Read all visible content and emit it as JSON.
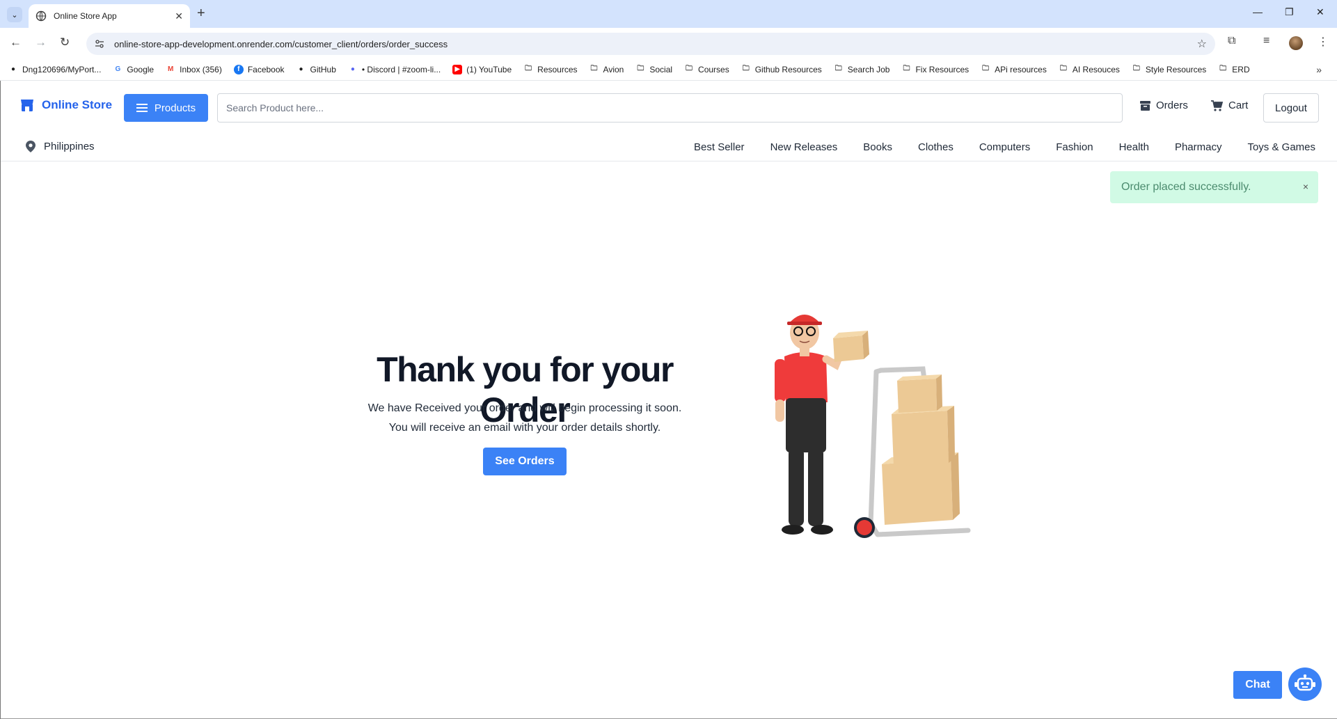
{
  "browser": {
    "tab_title": "Online Store App",
    "url": "online-store-app-development.onrender.com/customer_client/orders/order_success",
    "bookmarks": [
      {
        "label": "Dng120696/MyPort...",
        "icon": "github-icon"
      },
      {
        "label": "Google",
        "icon": "google-icon"
      },
      {
        "label": "Inbox (356)",
        "icon": "gmail-icon"
      },
      {
        "label": "Facebook",
        "icon": "facebook-icon"
      },
      {
        "label": "GitHub",
        "icon": "github-icon"
      },
      {
        "label": "• Discord | #zoom-li...",
        "icon": "discord-icon"
      },
      {
        "label": "(1) YouTube",
        "icon": "youtube-icon"
      },
      {
        "label": "Resources",
        "icon": "folder-icon"
      },
      {
        "label": "Avion",
        "icon": "folder-icon"
      },
      {
        "label": "Social",
        "icon": "folder-icon"
      },
      {
        "label": "Courses",
        "icon": "folder-icon"
      },
      {
        "label": "Github Resources",
        "icon": "folder-icon"
      },
      {
        "label": "Search Job",
        "icon": "folder-icon"
      },
      {
        "label": "Fix Resources",
        "icon": "folder-icon"
      },
      {
        "label": "APi resources",
        "icon": "folder-icon"
      },
      {
        "label": "AI Resouces",
        "icon": "folder-icon"
      },
      {
        "label": "Style Resources",
        "icon": "folder-icon"
      },
      {
        "label": "ERD",
        "icon": "folder-icon"
      }
    ]
  },
  "header": {
    "brand": "Online Store",
    "products_label": "Products",
    "search_placeholder": "Search Product here...",
    "orders_label": "Orders",
    "cart_label": "Cart",
    "logout_label": "Logout"
  },
  "subnav": {
    "location": "Philippines",
    "categories": [
      "Best Seller",
      "New Releases",
      "Books",
      "Clothes",
      "Computers",
      "Fashion",
      "Health",
      "Pharmacy",
      "Toys & Games"
    ]
  },
  "toast": {
    "message": "Order placed successfully.",
    "close": "×"
  },
  "hero": {
    "title": "Thank you for your Order",
    "line1": "We have Received your order and will begin processing it soon.",
    "line2": "You will receive an email with your order details shortly.",
    "button": "See Orders"
  },
  "chat": {
    "label": "Chat"
  },
  "colors": {
    "primary": "#3b82f6",
    "brand": "#2563eb",
    "toast_bg": "#d1fae5",
    "toast_text": "#4b8b6e"
  }
}
